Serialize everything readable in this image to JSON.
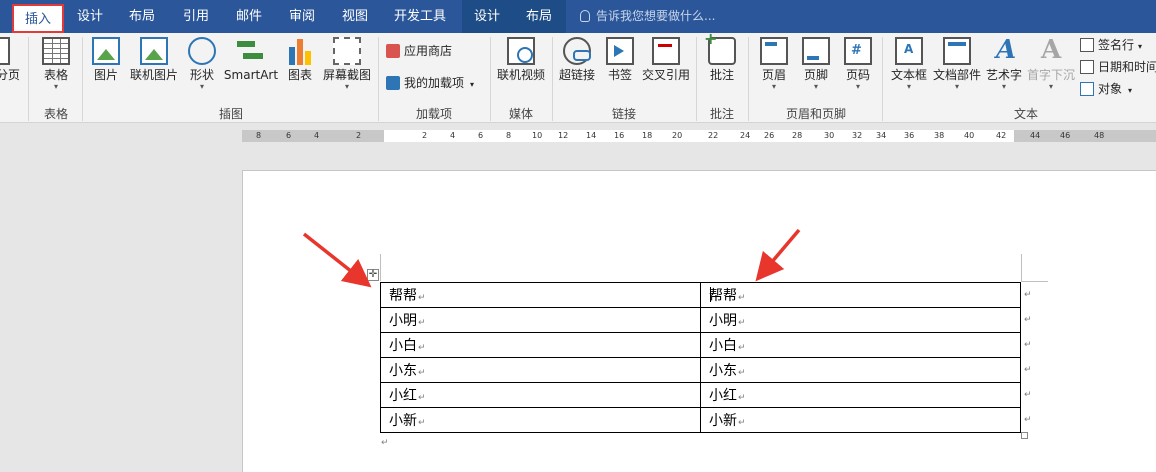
{
  "tabs": [
    {
      "label": "插入",
      "active": true
    },
    {
      "label": "设计"
    },
    {
      "label": "布局"
    },
    {
      "label": "引用"
    },
    {
      "label": "邮件"
    },
    {
      "label": "审阅"
    },
    {
      "label": "视图"
    },
    {
      "label": "开发工具"
    },
    {
      "label": "设计",
      "contextual": true
    },
    {
      "label": "布局",
      "contextual": true
    }
  ],
  "tell_me": "告诉我您想要做什么...",
  "ribbon": {
    "pages": {
      "partial_label": "分页"
    },
    "table": {
      "button": "表格",
      "group": "表格"
    },
    "illustrations": {
      "buttons": [
        "图片",
        "联机图片",
        "形状",
        "SmartArt",
        "图表",
        "屏幕截图"
      ],
      "group": "插图"
    },
    "addins": {
      "store": "应用商店",
      "my_addins": "我的加载项",
      "group": "加载项"
    },
    "media": {
      "button": "联机视频",
      "group": "媒体"
    },
    "links": {
      "buttons": [
        "超链接",
        "书签",
        "交叉引用"
      ],
      "group": "链接"
    },
    "comments": {
      "button": "批注",
      "group": "批注"
    },
    "header_footer": {
      "buttons": [
        "页眉",
        "页脚",
        "页码"
      ],
      "group": "页眉和页脚"
    },
    "text": {
      "buttons": [
        "文本框",
        "文档部件",
        "艺术字",
        "首字下沉"
      ],
      "small": [
        "签名行",
        "日期和时间",
        "对象"
      ],
      "group": "文本"
    }
  },
  "ruler_labels": [
    "8",
    "6",
    "4",
    "2",
    "2",
    "4",
    "6",
    "8",
    "10",
    "12",
    "14",
    "16",
    "18",
    "20",
    "22",
    "24",
    "26",
    "28",
    "30",
    "32",
    "34",
    "36",
    "38",
    "40",
    "42",
    "44",
    "46",
    "48"
  ],
  "table": {
    "rows": [
      [
        "帮帮",
        "帮帮"
      ],
      [
        "小明",
        "小明"
      ],
      [
        "小白",
        "小白"
      ],
      [
        "小东",
        "小东"
      ],
      [
        "小红",
        "小红"
      ],
      [
        "小新",
        "小新"
      ]
    ]
  },
  "marks": {
    "paragraph": "↵",
    "move_handle": "✛"
  },
  "colors": {
    "title_bar": "#2b579a",
    "active_tab_border": "#e03a3a",
    "arrow": "#e8362d"
  }
}
